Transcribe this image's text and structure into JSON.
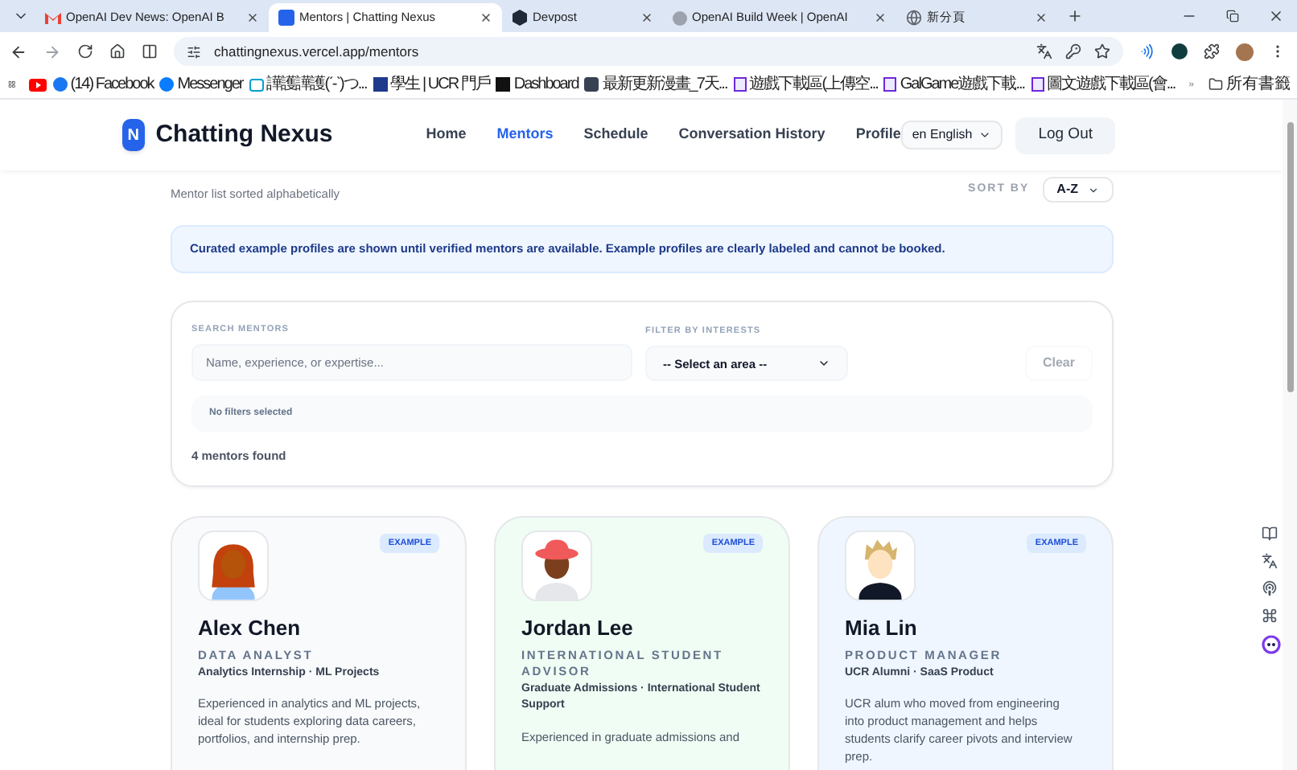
{
  "browser": {
    "tabs": [
      {
        "title": "OpenAI Dev News: OpenAI B",
        "kind": "mail",
        "selected": false
      },
      {
        "title": "Mentors | Chatting Nexus",
        "kind": "app",
        "selected": true
      },
      {
        "title": "Devpost",
        "kind": "hexagon",
        "selected": false
      },
      {
        "title": "OpenAI Build Week | OpenAI",
        "kind": "dot",
        "selected": false
      },
      {
        "title": "新分頁",
        "kind": "globe",
        "selected": false
      }
    ],
    "url": "chattingnexus.vercel.app/mentors",
    "bookmarks": [
      {
        "kind": "video"
      },
      {
        "label": "(14) Facebook",
        "kind": "facebook"
      },
      {
        "label": "Messenger",
        "kind": "messenger"
      },
      {
        "label": "譁護譁護(ˊ-ˋ)つ...",
        "kind": "tv"
      },
      {
        "label": "學生 | UCR 門戶",
        "kind": "r"
      },
      {
        "label": "Dashboard",
        "kind": "dark"
      },
      {
        "label": "最新更新漫畫_7天...",
        "kind": "bus"
      },
      {
        "label": "遊戲下載區(上傳空...",
        "kind": "page"
      },
      {
        "label": "GalGame遊戲下載...",
        "kind": "page"
      },
      {
        "label": "圖文遊戲下載區(會...",
        "kind": "page"
      }
    ],
    "all_bookmarks": "所有書籤"
  },
  "header": {
    "logo_letter": "N",
    "brand": "Chatting Nexus",
    "nav": [
      {
        "label": "Home",
        "selected": false
      },
      {
        "label": "Mentors",
        "selected": true
      },
      {
        "label": "Schedule",
        "selected": false
      },
      {
        "label": "Conversation History",
        "selected": false
      },
      {
        "label": "Profile",
        "selected": false
      }
    ],
    "language": "en English",
    "logout": "Log Out"
  },
  "subtitle": "Mentor list sorted alphabetically",
  "sort": {
    "label": "SORT BY",
    "value": "A-Z"
  },
  "notice": "Curated example profiles are shown until verified mentors are available. Example profiles are clearly labeled and cannot be booked.",
  "filters": {
    "search_label": "SEARCH MENTORS",
    "placeholder": "Name, experience, or expertise...",
    "interest_label": "FILTER BY INTERESTS",
    "interest_value": "-- Select an area --",
    "clear": {
      "label": "Clear",
      "disabled": true
    },
    "chips_text": "No filters selected",
    "count": "4 mentors found"
  },
  "mentors": [
    {
      "name": "Alex Chen",
      "role": "DATA ANALYST",
      "tags": "Analytics Internship · ML Projects",
      "bio": "Experienced in analytics and ML projects, ideal for students exploring data careers, portfolios, and internship prep.",
      "badge": "EXAMPLE",
      "color": "#f8fafc",
      "kind": "long-hair"
    },
    {
      "name": "Jordan Lee",
      "role": "INTERNATIONAL STUDENT ADVISOR",
      "tags": "Graduate Admissions · International Student Support",
      "bio": "Experienced in graduate admissions and",
      "badge": "EXAMPLE",
      "color": "#f0fdf4",
      "kind": "hat"
    },
    {
      "name": "Mia Lin",
      "role": "PRODUCT MANAGER",
      "tags": "UCR Alumni · SaaS Product",
      "bio": "UCR alum who moved from engineering into product management and helps students clarify career pivots and interview prep.",
      "badge": "EXAMPLE",
      "color": "#eff6ff",
      "kind": "spiky"
    }
  ]
}
